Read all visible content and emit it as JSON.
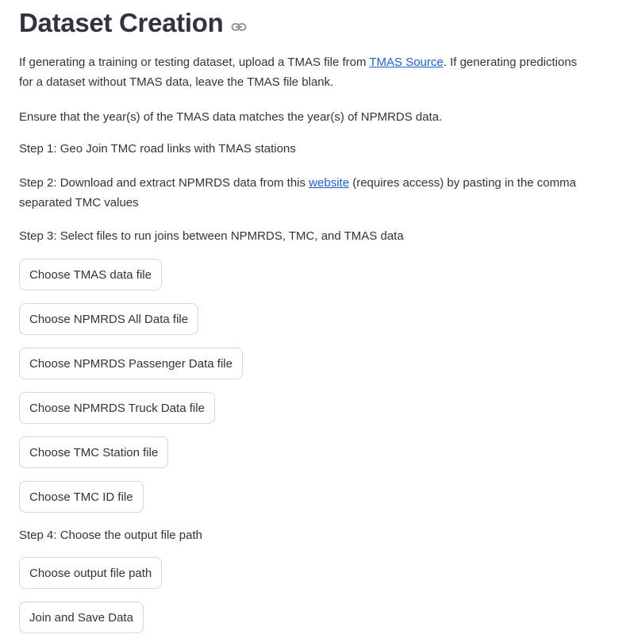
{
  "title": "Dataset Creation",
  "intro": {
    "part1": "If generating a training or testing dataset, upload a TMAS file from ",
    "link": "TMAS Source",
    "part2": ". If generating predictions for a dataset without TMAS data, leave the TMAS file blank."
  },
  "ensure": "Ensure that the year(s) of the TMAS data matches the year(s) of NPMRDS data.",
  "step1": "Step 1: Geo Join TMC road links with TMAS stations",
  "step2": {
    "part1": "Step 2: Download and extract NPMRDS data from this ",
    "link": "website",
    "part2": " (requires access) by pasting in the comma separated TMC values"
  },
  "step3": "Step 3: Select files to run joins between NPMRDS, TMC, and TMAS data",
  "buttons": {
    "tmas": "Choose TMAS data file",
    "npmrds_all": "Choose NPMRDS All Data file",
    "npmrds_passenger": "Choose NPMRDS Passenger Data file",
    "npmrds_truck": "Choose NPMRDS Truck Data file",
    "tmc_station": "Choose TMC Station file",
    "tmc_id": "Choose TMC ID file",
    "output_path": "Choose output file path",
    "join_save": "Join and Save Data"
  },
  "step4": "Step 4: Choose the output file path"
}
